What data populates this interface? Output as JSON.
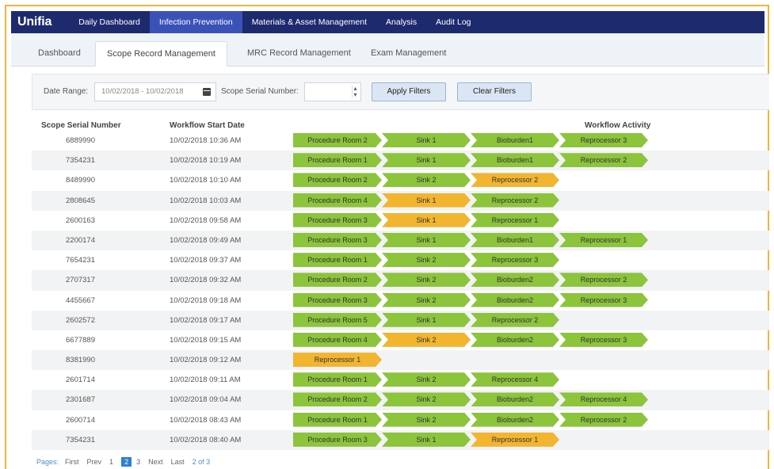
{
  "nav": {
    "brand": "Unifia",
    "items": [
      "Daily Dashboard",
      "Infection Prevention",
      "Materials & Asset Management",
      "Analysis",
      "Audit Log"
    ],
    "active_index": 1
  },
  "subtabs": {
    "items": [
      "Dashboard",
      "Scope Record Management",
      "MRC Record Management",
      "Exam Management"
    ],
    "active_index": 1
  },
  "filters": {
    "date_range_label": "Date Range:",
    "date_range_value": "10/02/2018 - 10/02/2018",
    "serial_label": "Scope Serial Number:",
    "serial_value": "",
    "apply_label": "Apply Filters",
    "clear_label": "Clear Filters"
  },
  "table": {
    "headers": {
      "serial": "Scope Serial Number",
      "start": "Workflow Start Date",
      "activity": "Workflow Activity"
    },
    "rows": [
      {
        "serial": "6889990",
        "start": "10/02/2018 10:36 AM",
        "steps": [
          {
            "label": "Procedure Room 2",
            "status": "green"
          },
          {
            "label": "Sink 1",
            "status": "green"
          },
          {
            "label": "Bioburden1",
            "status": "green"
          },
          {
            "label": "Reprocessor 3",
            "status": "green"
          }
        ]
      },
      {
        "serial": "7354231",
        "start": "10/02/2018 10:19 AM",
        "steps": [
          {
            "label": "Procedure Room 1",
            "status": "green"
          },
          {
            "label": "Sink 1",
            "status": "green"
          },
          {
            "label": "Bioburden1",
            "status": "green"
          },
          {
            "label": "Reprocessor 2",
            "status": "green"
          }
        ]
      },
      {
        "serial": "8489990",
        "start": "10/02/2018 10:10 AM",
        "steps": [
          {
            "label": "Procedure Room 2",
            "status": "green"
          },
          {
            "label": "Sink 2",
            "status": "green"
          },
          {
            "label": "Reprocessor 2",
            "status": "yellow"
          }
        ]
      },
      {
        "serial": "2808645",
        "start": "10/02/2018 10:03 AM",
        "steps": [
          {
            "label": "Procedure Room 4",
            "status": "green"
          },
          {
            "label": "Sink 1",
            "status": "yellow"
          },
          {
            "label": "Reprocessor 2",
            "status": "green"
          }
        ]
      },
      {
        "serial": "2600163",
        "start": "10/02/2018 09:58 AM",
        "steps": [
          {
            "label": "Procedure Room 3",
            "status": "green"
          },
          {
            "label": "Sink 1",
            "status": "yellow"
          },
          {
            "label": "Reprocessor 1",
            "status": "green"
          }
        ]
      },
      {
        "serial": "2200174",
        "start": "10/02/2018 09:49 AM",
        "steps": [
          {
            "label": "Procedure Room 3",
            "status": "green"
          },
          {
            "label": "Sink 1",
            "status": "green"
          },
          {
            "label": "Bioburden1",
            "status": "green"
          },
          {
            "label": "Reprocessor 1",
            "status": "green"
          }
        ]
      },
      {
        "serial": "7654231",
        "start": "10/02/2018 09:37 AM",
        "steps": [
          {
            "label": "Procedure Room 1",
            "status": "green"
          },
          {
            "label": "Sink 2",
            "status": "green"
          },
          {
            "label": "Reprocessor 3",
            "status": "green"
          }
        ]
      },
      {
        "serial": "2707317",
        "start": "10/02/2018 09:32 AM",
        "steps": [
          {
            "label": "Procedure Room 2",
            "status": "green"
          },
          {
            "label": "Sink 2",
            "status": "green"
          },
          {
            "label": "Bioburden2",
            "status": "green"
          },
          {
            "label": "Reprocessor 2",
            "status": "green"
          }
        ]
      },
      {
        "serial": "4455667",
        "start": "10/02/2018 09:18 AM",
        "steps": [
          {
            "label": "Procedure Room 3",
            "status": "green"
          },
          {
            "label": "Sink 2",
            "status": "green"
          },
          {
            "label": "Bioburden2",
            "status": "green"
          },
          {
            "label": "Reprocessor 3",
            "status": "green"
          }
        ]
      },
      {
        "serial": "2602572",
        "start": "10/02/2018 09:17 AM",
        "steps": [
          {
            "label": "Procedure Room 5",
            "status": "green"
          },
          {
            "label": "Sink 1",
            "status": "green"
          },
          {
            "label": "Reprocessor 2",
            "status": "green"
          }
        ]
      },
      {
        "serial": "6677889",
        "start": "10/02/2018 09:15 AM",
        "steps": [
          {
            "label": "Procedure Room 4",
            "status": "green"
          },
          {
            "label": "Sink 2",
            "status": "yellow"
          },
          {
            "label": "Bioburden2",
            "status": "green"
          },
          {
            "label": "Reprocessor 3",
            "status": "green"
          }
        ]
      },
      {
        "serial": "8381990",
        "start": "10/02/2018 09:12 AM",
        "steps": [
          {
            "label": "Reprocessor 1",
            "status": "yellow"
          }
        ]
      },
      {
        "serial": "2601714",
        "start": "10/02/2018 09:11 AM",
        "steps": [
          {
            "label": "Procedure Room 1",
            "status": "green"
          },
          {
            "label": "Sink 2",
            "status": "green"
          },
          {
            "label": "Reprocessor 4",
            "status": "green"
          }
        ]
      },
      {
        "serial": "2301687",
        "start": "10/02/2018 09:04 AM",
        "steps": [
          {
            "label": "Procedure Room 2",
            "status": "green"
          },
          {
            "label": "Sink 2",
            "status": "green"
          },
          {
            "label": "Bioburden2",
            "status": "green"
          },
          {
            "label": "Reprocessor 4",
            "status": "green"
          }
        ]
      },
      {
        "serial": "2600714",
        "start": "10/02/2018 08:43 AM",
        "steps": [
          {
            "label": "Procedure Room 1",
            "status": "green"
          },
          {
            "label": "Sink 2",
            "status": "green"
          },
          {
            "label": "Bioburden2",
            "status": "green"
          },
          {
            "label": "Reprocessor 2",
            "status": "green"
          }
        ]
      },
      {
        "serial": "7354231",
        "start": "10/02/2018 08:40 AM",
        "steps": [
          {
            "label": "Procedure Room 3",
            "status": "green"
          },
          {
            "label": "Sink 1",
            "status": "green"
          },
          {
            "label": "Reprocessor 1",
            "status": "yellow"
          }
        ]
      }
    ]
  },
  "pager": {
    "label": "Pages:",
    "first": "First",
    "prev": "Prev",
    "pages": [
      "1",
      "2",
      "3"
    ],
    "current_index": 1,
    "next": "Next",
    "last": "Last",
    "info": "2 of 3"
  },
  "colors": {
    "nav_bg": "#1d2a6e",
    "nav_active": "#3a52b8",
    "frame_border": "#f0b43c",
    "step_green": "#8cc43c",
    "step_yellow": "#f2b530"
  }
}
